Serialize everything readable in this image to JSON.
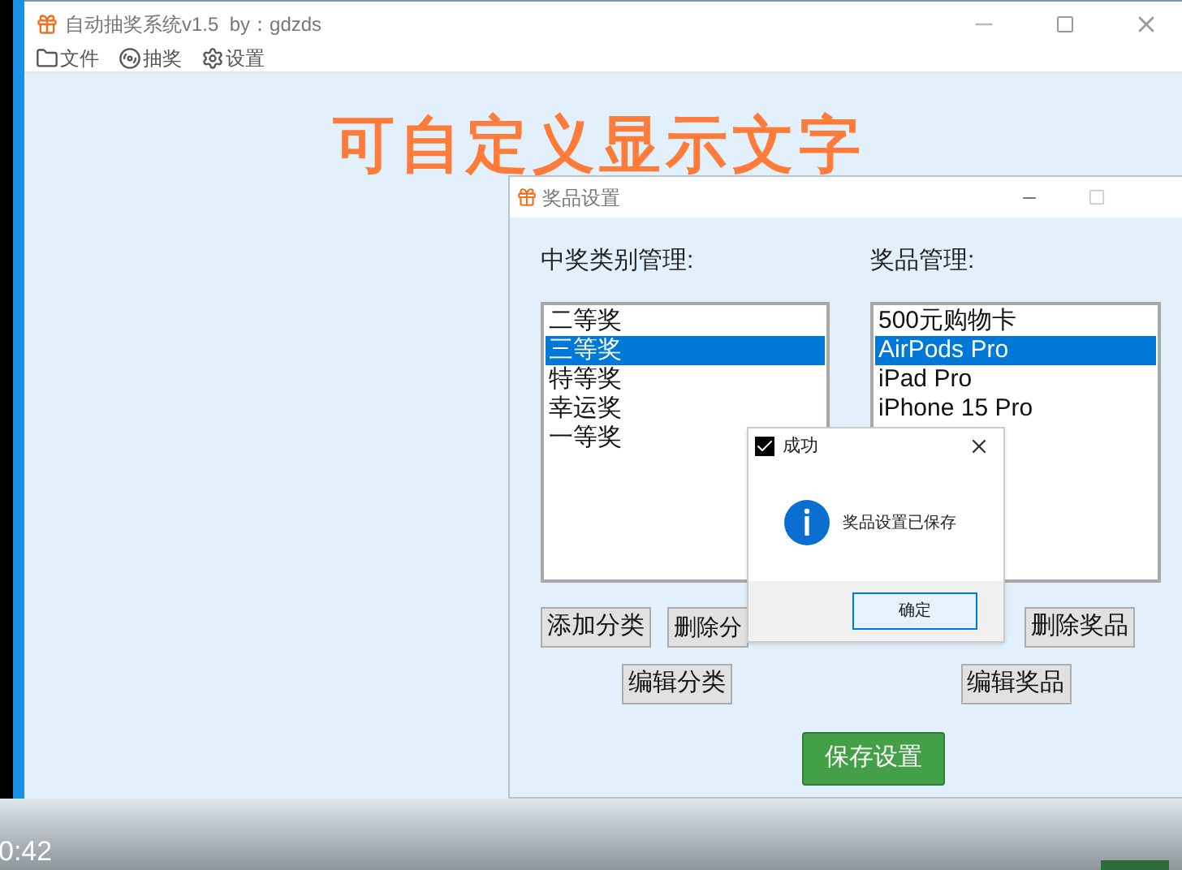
{
  "app": {
    "title": "自动抽奖系统v1.5  by：gdzds",
    "menu": [
      {
        "label": "文件",
        "kind": "folder"
      },
      {
        "label": "抽奖",
        "kind": "disc"
      },
      {
        "label": "设置",
        "kind": "gear"
      }
    ],
    "banner": "可自定义显示文字"
  },
  "dialog": {
    "title": "奖品设置",
    "category_label": "中奖类别管理:",
    "categories": [
      {
        "label": "二等奖",
        "selected": false
      },
      {
        "label": "三等奖",
        "selected": true
      },
      {
        "label": "特等奖",
        "selected": false
      },
      {
        "label": "幸运奖",
        "selected": false
      },
      {
        "label": "一等奖",
        "selected": false
      }
    ],
    "prize_label": "奖品管理:",
    "prizes": [
      {
        "label": "500元购物卡",
        "selected": false
      },
      {
        "label": "AirPods Pro",
        "selected": true
      },
      {
        "label": "iPad Pro",
        "selected": false
      },
      {
        "label": "iPhone 15 Pro",
        "selected": false
      }
    ],
    "add_category": "添加分类",
    "delete_category": "删除分",
    "edit_category": "编辑分类",
    "delete_prize": "删除奖品",
    "edit_prize": "编辑奖品",
    "save": "保存设置"
  },
  "message_box": {
    "title": "成功",
    "text": "奖品设置已保存",
    "ok": "确定"
  },
  "video": {
    "time": "0:42"
  }
}
